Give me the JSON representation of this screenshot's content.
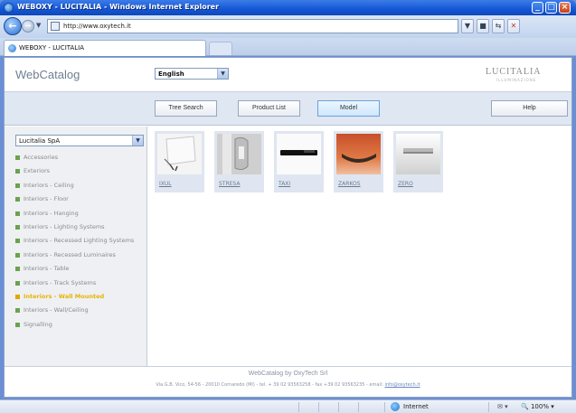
{
  "window": {
    "title": "WEBOXY - LUCITALIA - Windows Internet Explorer"
  },
  "browser": {
    "url": "http://www.oxytech.it",
    "tab_title": "WEBOXY - LUCITALIA",
    "status_zone": "Internet",
    "zoom": "100%"
  },
  "header": {
    "brand": "WebCatalog",
    "language": "English",
    "logo": "LUCITALIA",
    "logo_sub": "ILLUMINAZIONE"
  },
  "nav": {
    "tree_search": "Tree Search",
    "product_list": "Product List",
    "model": "Model",
    "help": "Help"
  },
  "sidebar": {
    "company": "Lucitalia SpA",
    "categories": [
      "Accessories",
      "Exteriors",
      "Interiors - Ceiling",
      "Interiors - Floor",
      "Interiors - Hanging",
      "Interiors - Lighting Systems",
      "Interiors - Recessed Lighting Systems",
      "Interiors - Recessed Luminaires",
      "Interiors - Table",
      "Interiors - Track Systems",
      "Interiors - Wall Mounted",
      "Interiors - Wall/Ceiling",
      "Signalling"
    ],
    "selected_index": 10
  },
  "products": [
    {
      "label": "IXUL"
    },
    {
      "label": "STRESA"
    },
    {
      "label": "TAXI"
    },
    {
      "label": "ZARKOS"
    },
    {
      "label": "ZERO"
    }
  ],
  "footer": {
    "line1": "WebCatalog by OxyTech Srl",
    "line2": "Via G.B. Vico, 54-56 - 20010 Cornaredo (MI) - tel. + 39 02 93563258 - fax +39 02 93563235 - email:",
    "email": "info@oxytech.it"
  },
  "colors": {
    "accent_selected": "#e8b300",
    "bullet": "#6aa34a",
    "nav_bar": "#dfe7f2"
  }
}
